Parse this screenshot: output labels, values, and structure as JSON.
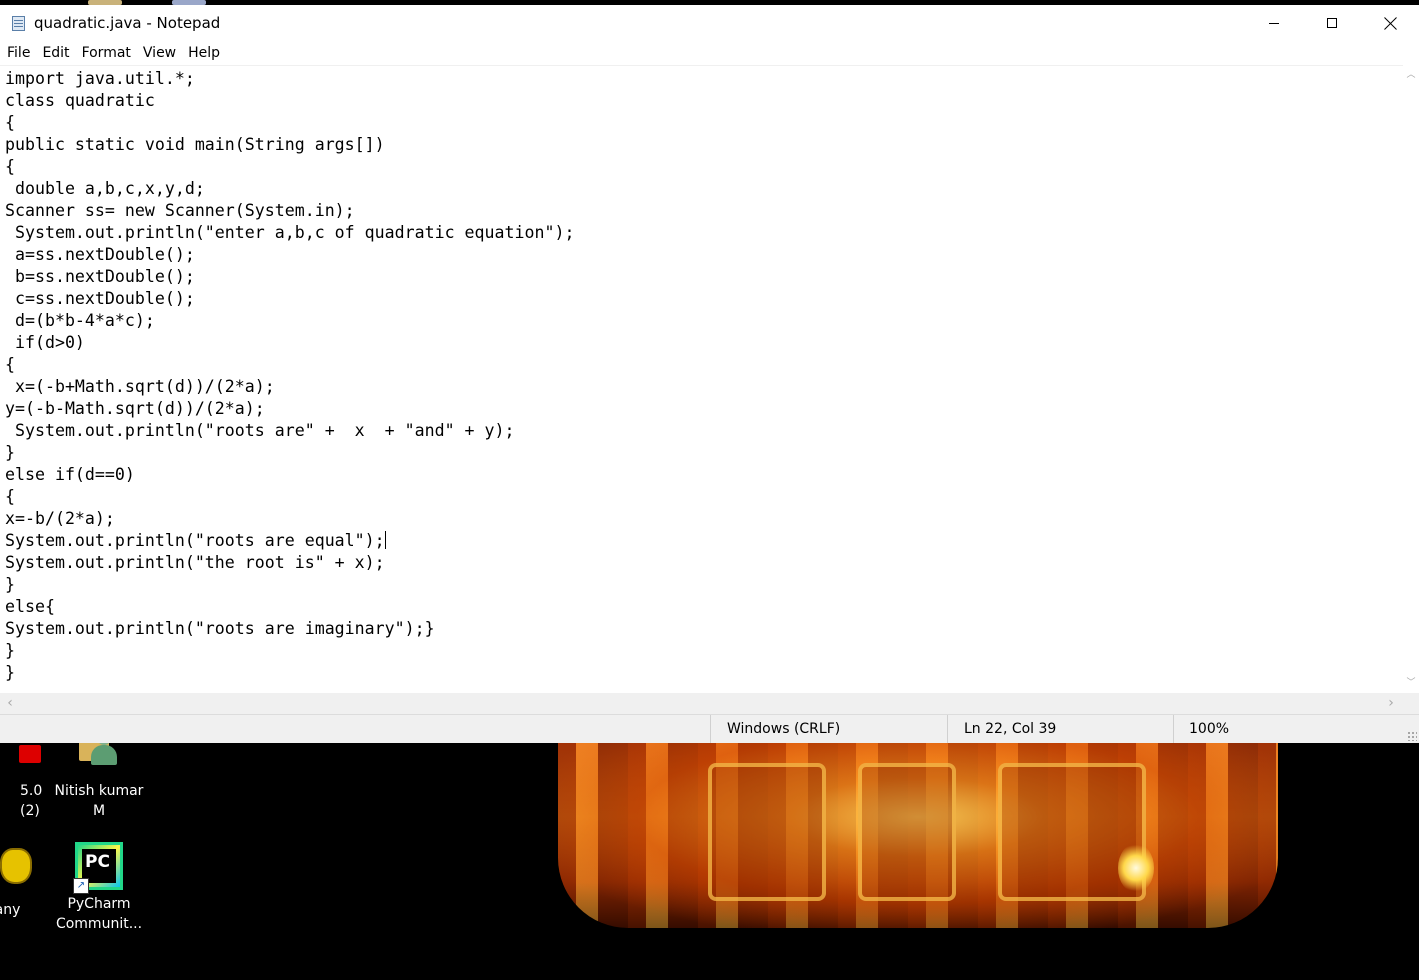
{
  "window": {
    "title": "quadratic.java - Notepad",
    "controls": [
      "minimize",
      "maximize",
      "close"
    ]
  },
  "menu": {
    "items": [
      "File",
      "Edit",
      "Format",
      "View",
      "Help"
    ]
  },
  "editor": {
    "lines": [
      "import java.util.*;",
      "class quadratic",
      "{",
      "public static void main(String args[])",
      "{",
      " double a,b,c,x,y,d;",
      "Scanner ss= new Scanner(System.in);",
      " System.out.println(\"enter a,b,c of quadratic equation\");",
      " a=ss.nextDouble();",
      " b=ss.nextDouble();",
      " c=ss.nextDouble();",
      " d=(b*b-4*a*c);",
      " if(d>0)",
      "{",
      " x=(-b+Math.sqrt(d))/(2*a);",
      "y=(-b-Math.sqrt(d))/(2*a);",
      " System.out.println(\"roots are\" +  x  + \"and\" + y);",
      "}",
      "else if(d==0)",
      "{",
      "x=-b/(2*a);",
      "System.out.println(\"roots are equal\");",
      "System.out.println(\"the root is\" + x);",
      "}",
      "else{",
      "System.out.println(\"roots are imaginary\");}",
      "}",
      "}"
    ],
    "caret_line": 22,
    "caret_col": 39
  },
  "status": {
    "line_ending": "Windows (CRLF)",
    "position": "Ln 22, Col 39",
    "zoom": "100%"
  },
  "desktop": {
    "icons": [
      {
        "label": "5.0 (2)",
        "icon": "app-icon-red"
      },
      {
        "label": "Nitish kumar M",
        "icon": "user-folder-icon"
      },
      {
        "label": "eany",
        "icon": "geany-teapot-icon"
      },
      {
        "label": "PyCharm Communit...",
        "icon": "pycharm-icon"
      }
    ],
    "colors": {
      "wallpaper_accent": "#f08a20",
      "background": "#000000"
    }
  }
}
